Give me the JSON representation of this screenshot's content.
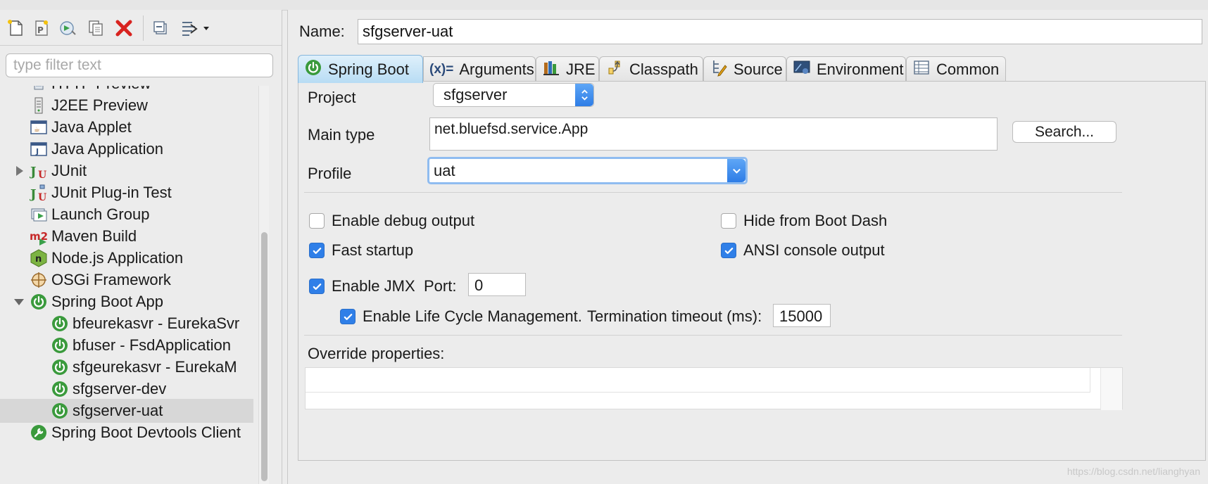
{
  "left_panel": {
    "toolbar": [
      {
        "name": "new-launch-config-icon"
      },
      {
        "name": "new-prototype-icon"
      },
      {
        "name": "export-config-icon"
      },
      {
        "name": "duplicate-icon"
      },
      {
        "name": "delete-icon",
        "color": "#d8231f"
      },
      {
        "name": "collapse-all-icon"
      },
      {
        "name": "filter-menu-icon"
      }
    ],
    "filter_placeholder": "type filter text",
    "tree": [
      {
        "label": "HTTP Preview",
        "icon": "file-icon",
        "level": 0
      },
      {
        "label": "J2EE Preview",
        "icon": "server-icon",
        "level": 0
      },
      {
        "label": "Java Applet",
        "icon": "java-applet-icon",
        "level": 0
      },
      {
        "label": "Java Application",
        "icon": "java-app-icon",
        "level": 0
      },
      {
        "label": "JUnit",
        "icon": "junit-icon",
        "level": 0,
        "expand": "collapsed"
      },
      {
        "label": "JUnit Plug-in Test",
        "icon": "junit-plugin-icon",
        "level": 0
      },
      {
        "label": "Launch Group",
        "icon": "launch-group-icon",
        "level": 0
      },
      {
        "label": "Maven Build",
        "icon": "maven-icon",
        "level": 0
      },
      {
        "label": "Node.js Application",
        "icon": "nodejs-icon",
        "level": 0
      },
      {
        "label": "OSGi Framework",
        "icon": "osgi-icon",
        "level": 0
      },
      {
        "label": "Spring Boot App",
        "icon": "spring-boot-icon",
        "level": 0,
        "expand": "expanded"
      },
      {
        "label": "bfeurekasvr - EurekaSvr",
        "icon": "spring-boot-icon",
        "level": 1
      },
      {
        "label": "bfuser - FsdApplication",
        "icon": "spring-boot-icon",
        "level": 1
      },
      {
        "label": "sfgeurekasvr - EurekaM",
        "icon": "spring-boot-icon",
        "level": 1
      },
      {
        "label": "sfgserver-dev",
        "icon": "spring-boot-icon",
        "level": 1
      },
      {
        "label": "sfgserver-uat",
        "icon": "spring-boot-icon",
        "level": 1,
        "selected": true
      },
      {
        "label": "Spring Boot Devtools Client",
        "icon": "devtools-icon",
        "level": 0
      }
    ]
  },
  "config": {
    "name_label": "Name:",
    "name_value": "sfgserver-uat",
    "tabs": [
      {
        "label": "Spring Boot",
        "icon": "spring-boot-icon",
        "active": true
      },
      {
        "label": "Arguments",
        "icon": "arguments-icon"
      },
      {
        "label": "JRE",
        "icon": "jre-icon"
      },
      {
        "label": "Classpath",
        "icon": "classpath-icon"
      },
      {
        "label": "Source",
        "icon": "source-icon"
      },
      {
        "label": "Environment",
        "icon": "environment-icon"
      },
      {
        "label": "Common",
        "icon": "common-icon"
      }
    ],
    "arguments_prefix": "(x)=",
    "project_label": "Project",
    "project_value": "sfgserver",
    "main_type_label": "Main type",
    "main_type_value": "net.bluefsd.service.App",
    "search_button": "Search...",
    "profile_label": "Profile",
    "profile_value": "uat",
    "checkboxes": {
      "debug": {
        "label": "Enable debug output",
        "checked": false
      },
      "hide": {
        "label": "Hide from Boot Dash",
        "checked": false
      },
      "fast": {
        "label": "Fast startup",
        "checked": true
      },
      "ansi": {
        "label": "ANSI console output",
        "checked": true
      },
      "jmx": {
        "label": "Enable JMX",
        "checked": true
      },
      "lifecycle": {
        "label": "Enable Life Cycle Management.",
        "checked": true
      }
    },
    "port_label": "Port:",
    "port_value": "0",
    "termination_label": "Termination timeout (ms):",
    "termination_value": "15000",
    "override_label": "Override properties:",
    "accent_color": "#2f7fe8",
    "spring_green": "#3a9a3c"
  },
  "watermark": "https://blog.csdn.net/lianghyan"
}
